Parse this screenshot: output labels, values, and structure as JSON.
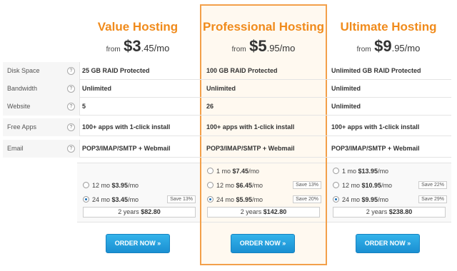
{
  "plans": [
    {
      "name": "Value Hosting",
      "from": "from",
      "price_main": "$3",
      "price_cents": ".45",
      "per": "/mo",
      "features": {
        "disk_space": "25 GB RAID Protected",
        "bandwidth": "Unlimited",
        "website": "5",
        "free_apps": "100+ apps with 1-click install",
        "email": "POP3/IMAP/SMTP + Webmail"
      },
      "options": [
        {
          "term": "12 mo",
          "price": "$3.95",
          "per": "/mo",
          "save": "",
          "selected": false
        },
        {
          "term": "24 mo",
          "price": "$3.45",
          "per": "/mo",
          "save": "Save 13%",
          "selected": true
        }
      ],
      "total_label": "2 years",
      "total_value": "$82.80",
      "button": "ORDER NOW »"
    },
    {
      "name": "Professional Hosting",
      "from": "from",
      "price_main": "$5",
      "price_cents": ".95",
      "per": "/mo",
      "features": {
        "disk_space": "100 GB RAID Protected",
        "bandwidth": "Unlimited",
        "website": "26",
        "free_apps": "100+ apps with 1-click install",
        "email": "POP3/IMAP/SMTP + Webmail"
      },
      "options": [
        {
          "term": "1 mo",
          "price": "$7.45",
          "per": "/mo",
          "save": "",
          "selected": false
        },
        {
          "term": "12 mo",
          "price": "$6.45",
          "per": "/mo",
          "save": "Save 13%",
          "selected": false
        },
        {
          "term": "24 mo",
          "price": "$5.95",
          "per": "/mo",
          "save": "Save 20%",
          "selected": true
        }
      ],
      "total_label": "2 years",
      "total_value": "$142.80",
      "button": "ORDER NOW »"
    },
    {
      "name": "Ultimate Hosting",
      "from": "from",
      "price_main": "$9",
      "price_cents": ".95",
      "per": "/mo",
      "features": {
        "disk_space": "Unlimited GB RAID Protected",
        "bandwidth": "Unlimited",
        "website": "Unlimited",
        "free_apps": "100+ apps with 1-click install",
        "email": "POP3/IMAP/SMTP + Webmail"
      },
      "options": [
        {
          "term": "1 mo",
          "price": "$13.95",
          "per": "/mo",
          "save": "",
          "selected": false
        },
        {
          "term": "12 mo",
          "price": "$10.95",
          "per": "/mo",
          "save": "Save 22%",
          "selected": false
        },
        {
          "term": "24 mo",
          "price": "$9.95",
          "per": "/mo",
          "save": "Save 29%",
          "selected": true
        }
      ],
      "total_label": "2 years",
      "total_value": "$238.80",
      "button": "ORDER NOW »"
    }
  ],
  "feature_labels": {
    "disk_space": "Disk Space",
    "bandwidth": "Bandwidth",
    "website": "Website",
    "free_apps": "Free Apps",
    "email": "Email"
  },
  "help_icon": "?",
  "icons": {
    "help": "question-circle-icon",
    "radio": "radio-button"
  },
  "colors": {
    "accent": "#f08b1c",
    "button": "#1a8fd2",
    "highlight_border": "#f3a04a"
  }
}
